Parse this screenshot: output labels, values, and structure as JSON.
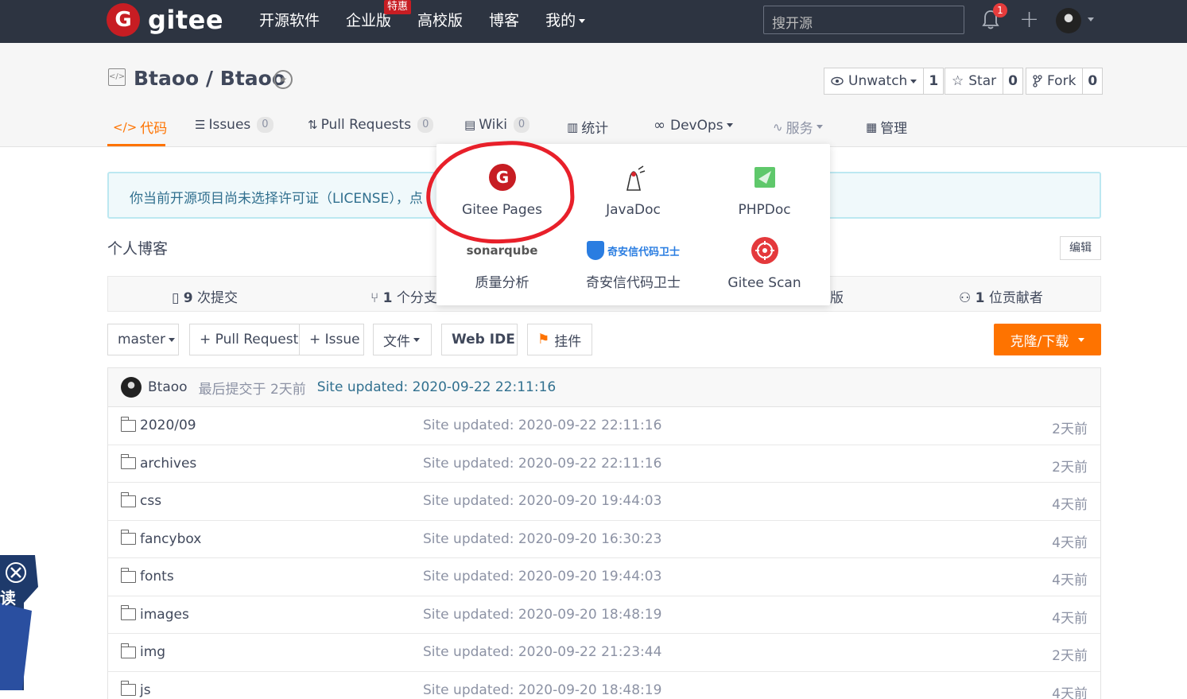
{
  "brand": {
    "name": "gitee",
    "logo_letter": "G",
    "brand_color": "#c71d23"
  },
  "topnav": {
    "items": [
      "开源软件",
      "企业版",
      "高校版",
      "博客",
      "我的"
    ],
    "badge": "特惠",
    "search_placeholder": "搜开源",
    "notification_count": "1"
  },
  "project": {
    "title": "Btaoo / Btaoo",
    "unwatch_label": "Unwatch",
    "unwatch_count": "1",
    "star_label": "Star",
    "star_count": "0",
    "fork_label": "Fork",
    "fork_count": "0"
  },
  "tabs": [
    {
      "label": "代码",
      "count": null
    },
    {
      "label": "Issues",
      "count": "0"
    },
    {
      "label": "Pull Requests",
      "count": "0"
    },
    {
      "label": "Wiki",
      "count": "0"
    },
    {
      "label": "统计",
      "count": null
    },
    {
      "label": "DevOps",
      "count": null
    },
    {
      "label": "服务",
      "count": null
    },
    {
      "label": "管理",
      "count": null
    }
  ],
  "notice": {
    "text": "你当前开源项目尚未选择许可证（LICENSE），点"
  },
  "description": {
    "text": "个人博客",
    "edit_label": "编辑"
  },
  "stats": {
    "commits_num": "9",
    "commits_label": "次提交",
    "branches_num": "1",
    "branches_label": "个分支",
    "releases_tail": "版",
    "contributors_num": "1",
    "contributors_label": "位贡献者"
  },
  "toolbar": {
    "branch": "master",
    "pull_request": "+ Pull Request",
    "issue": "+ Issue",
    "files": "文件",
    "web_ide": "Web IDE",
    "widget": "挂件",
    "clone": "克隆/下载",
    "accent_color": "#fe7300"
  },
  "last_commit": {
    "author": "Btaoo",
    "time": "最后提交于 2天前",
    "message": "Site updated: 2020-09-22 22:11:16"
  },
  "files": [
    {
      "name": "2020/09",
      "message": "Site updated: 2020-09-22 22:11:16",
      "time": "2天前"
    },
    {
      "name": "archives",
      "message": "Site updated: 2020-09-22 22:11:16",
      "time": "2天前"
    },
    {
      "name": "css",
      "message": "Site updated: 2020-09-20 19:44:03",
      "time": "4天前"
    },
    {
      "name": "fancybox",
      "message": "Site updated: 2020-09-20 16:30:23",
      "time": "4天前"
    },
    {
      "name": "fonts",
      "message": "Site updated: 2020-09-20 19:44:03",
      "time": "4天前"
    },
    {
      "name": "images",
      "message": "Site updated: 2020-09-20 18:48:19",
      "time": "4天前"
    },
    {
      "name": "img",
      "message": "Site updated: 2020-09-22 21:23:44",
      "time": "2天前"
    },
    {
      "name": "js",
      "message": "Site updated: 2020-09-20 18:48:19",
      "time": "4天前"
    }
  ],
  "services_menu": {
    "items": [
      "Gitee Pages",
      "JavaDoc",
      "PHPDoc",
      "质量分析",
      "奇安信代码卫士",
      "Gitee Scan"
    ],
    "sonarqube_logo_text": "sonarqube",
    "qianxin_logo_text": "奇安信代码卫士"
  },
  "float_widget": {
    "text": "读"
  }
}
